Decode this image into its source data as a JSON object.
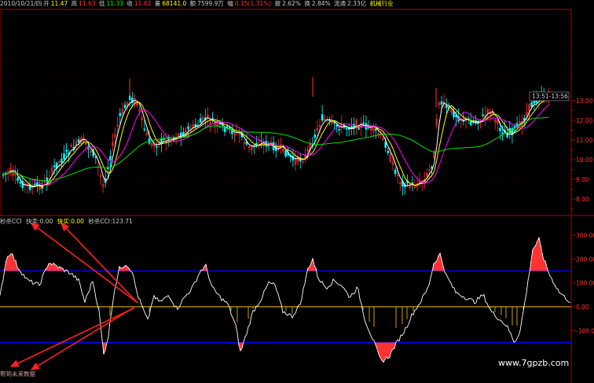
{
  "status": {
    "date": "2010/10/21/四",
    "open_label": "开",
    "open": "11.47",
    "high_label": "高",
    "high": "11.63",
    "low_label": "低",
    "low": "11.33",
    "close_label": "收",
    "close": "11.62",
    "volume_label": "量",
    "volume": "68141.0",
    "amount_label": "额",
    "amount": "7599.9万",
    "change_label": "幅",
    "change": "0.15(1.31%)",
    "amplitude_label": "振",
    "amplitude": "2.62%",
    "turnover_label": "换",
    "turnover": "2.84%",
    "float_label": "流通",
    "float": "2.33亿",
    "industry": "机械行业"
  },
  "price_panel": {
    "time_tag": "13:51-13:56",
    "y_ticks": [
      "13.00",
      "12.00",
      "11.00",
      "10.00",
      "9.00",
      "8.00"
    ]
  },
  "indicator": {
    "name": "秒杀CCI",
    "fast_sell_label": "快卖:",
    "fast_sell": "0.00",
    "fast_buy_label": "快买:",
    "fast_buy": "0.00",
    "value_label": "秒杀CCI:",
    "value": "123.71",
    "y_ticks": [
      "300.00",
      "200.00",
      "100.00",
      "0.00",
      "-100.00"
    ]
  },
  "bottom_text": "帮到未来数据",
  "watermark": "www.7gpzb.com",
  "colors": {
    "background": "#000000",
    "up": "#ff3232",
    "down": "#00ffff",
    "axis": "#b00000",
    "ma_white": "#ffffff",
    "ma_yellow": "#ffff00",
    "ma_magenta": "#ff00ff",
    "ma_green": "#00e000",
    "band": "#0000ff",
    "zero_line": "#c8a000",
    "arrow": "#ff2020"
  }
}
